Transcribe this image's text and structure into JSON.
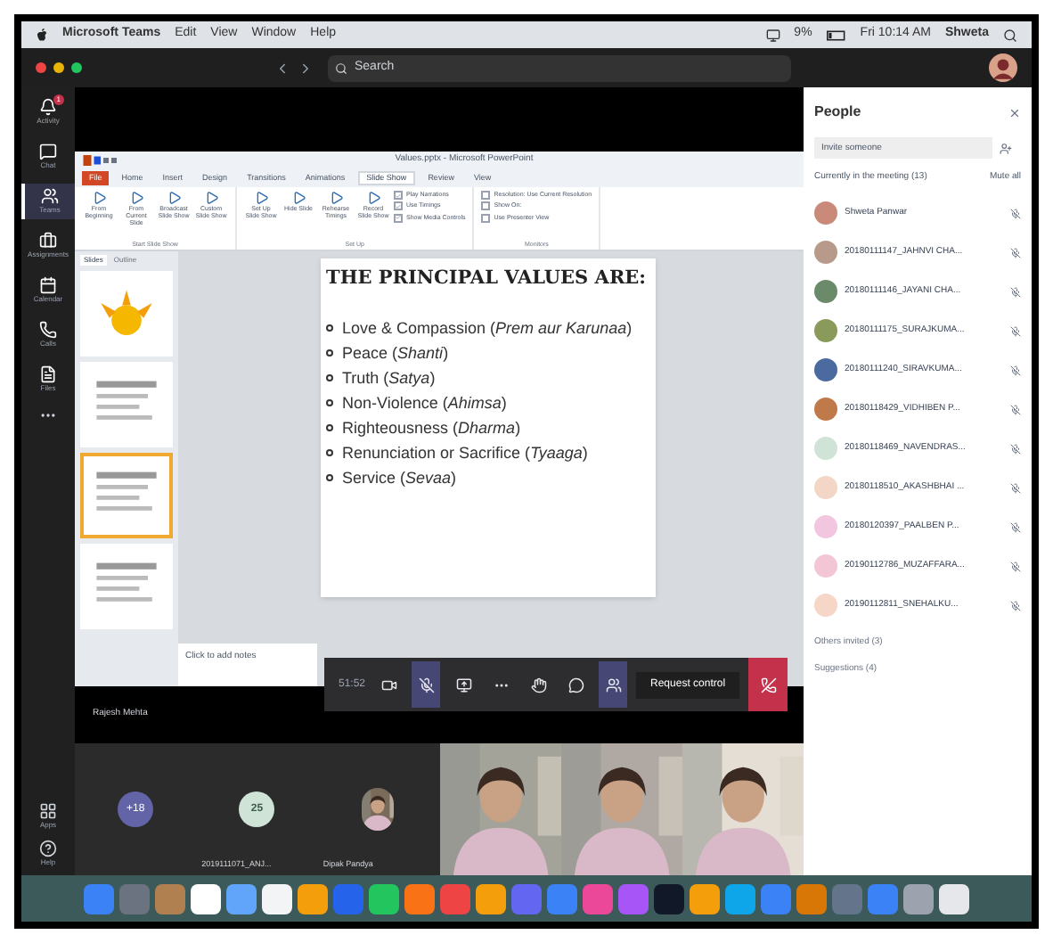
{
  "menubar": {
    "app": "Microsoft Teams",
    "menus": [
      "Edit",
      "View",
      "Window",
      "Help"
    ],
    "battery": "9%",
    "clock": "Fri 10:14 AM",
    "user": "Shweta"
  },
  "teams_bar": {
    "search": {
      "placeholder": "Search"
    }
  },
  "rail": {
    "items": [
      {
        "label": "Activity",
        "selected": false,
        "badge": "1"
      },
      {
        "label": "Chat",
        "selected": false
      },
      {
        "label": "Teams",
        "selected": true
      },
      {
        "label": "Assignments",
        "selected": false
      },
      {
        "label": "Calendar",
        "selected": false
      },
      {
        "label": "Calls",
        "selected": false
      },
      {
        "label": "Files",
        "selected": false
      }
    ],
    "bottom": [
      "Apps",
      "Help"
    ]
  },
  "powerpoint": {
    "title": "Values.pptx - Microsoft PowerPoint",
    "tabs": [
      {
        "label": "File",
        "selected": false,
        "kind": "file"
      },
      {
        "label": "Home",
        "selected": false
      },
      {
        "label": "Insert",
        "selected": false
      },
      {
        "label": "Design",
        "selected": false
      },
      {
        "label": "Transitions",
        "selected": false
      },
      {
        "label": "Animations",
        "selected": false
      },
      {
        "label": "Slide Show",
        "selected": true
      },
      {
        "label": "Review",
        "selected": false
      },
      {
        "label": "View",
        "selected": false
      }
    ],
    "ribbon_groups": [
      {
        "label": "Start Slide Show",
        "buttons": [
          "From Beginning",
          "From Current Slide",
          "Broadcast Slide Show",
          "Custom Slide Show"
        ]
      },
      {
        "label": "Set Up",
        "buttons": [
          "Set Up Slide Show",
          "Hide Slide",
          "Rehearse Timings",
          "Record Slide Show"
        ],
        "options": [
          {
            "label": "Play Narrations",
            "checked": true
          },
          {
            "label": "Use Timings",
            "checked": true
          },
          {
            "label": "Show Media Controls",
            "checked": true
          }
        ]
      },
      {
        "label": "Monitors",
        "options": [
          {
            "label": "Resolution: Use Current Resolution",
            "checked": false
          },
          {
            "label": "Show On:",
            "checked": false
          },
          {
            "label": "Use Presenter View",
            "checked": false
          }
        ]
      }
    ],
    "pane_tabs": [
      {
        "label": "Slides",
        "selected": true
      },
      {
        "label": "Outline",
        "selected": false
      }
    ],
    "thumbnails": [
      {
        "selected": false
      },
      {
        "selected": false
      },
      {
        "selected": true
      },
      {
        "selected": false
      }
    ],
    "slide": {
      "title": "THE PRINCIPAL VALUES ARE:",
      "bullets": [
        "Love & Compassion (*Prem aur Karunaa*)",
        "Peace (*Shanti*)",
        "Truth (*Satya*)",
        "Non-Violence (*Ahimsa*)",
        "Righteousness (*Dharma*)",
        "Renunciation or Sacrifice (*Tyaaga*)",
        "Service (*Sevaa*)"
      ]
    },
    "notes": {
      "placeholder": "Click to add notes"
    }
  },
  "call_controls": {
    "timer": "51:52",
    "buttons": [
      {
        "kind": "video",
        "selected": false
      },
      {
        "kind": "mic",
        "selected": true
      },
      {
        "kind": "share",
        "selected": false
      },
      {
        "kind": "more",
        "selected": false
      },
      {
        "kind": "hand",
        "selected": false
      },
      {
        "kind": "chat",
        "selected": false
      },
      {
        "kind": "people",
        "selected": true
      }
    ],
    "request": "Request control"
  },
  "presenter": "Rajesh Mehta",
  "tiles": [
    {
      "kind": "count",
      "text": "+18"
    },
    {
      "kind": "avatar",
      "initials": "25",
      "name": "2019111071_ANJ..."
    },
    {
      "name": "Dipak Pandya"
    },
    {
      "kind": "video"
    },
    {
      "kind": "video"
    },
    {
      "kind": "video"
    }
  ],
  "people": {
    "title": "People",
    "invite": {
      "placeholder": "Invite someone"
    },
    "section": "Currently in the meeting (13)",
    "mute_all": "Mute all",
    "members": [
      {
        "name": "Shweta Panwar",
        "color": "#c98a7a"
      },
      {
        "name": "20180111147_JAHNVI CHA...",
        "color": "#b89a8a"
      },
      {
        "name": "20180111146_JAYANI CHA...",
        "color": "#6a8a6a"
      },
      {
        "name": "20180111175_SURAJKUMA...",
        "color": "#8a9a5a"
      },
      {
        "name": "20180111240_SIRAVKUMA...",
        "color": "#4a6aa0"
      },
      {
        "name": "20180118429_VIDHIBEN P...",
        "color": "#c07a4a"
      },
      {
        "name": "20180118469_NAVENDRAS...",
        "color": "#cfe3d6"
      },
      {
        "name": "20180118510_AKASHBHAI ...",
        "color": "#f3d6c6"
      },
      {
        "name": "20180120397_PAALBEN P...",
        "color": "#f2c6de"
      },
      {
        "name": "20190112786_MUZAFFARA...",
        "color": "#f2c6d4"
      },
      {
        "name": "20190112811_SNEHALKU...",
        "color": "#f6d6c6"
      }
    ],
    "others": "Others invited (3)",
    "suggestions": "Suggestions (4)"
  }
}
